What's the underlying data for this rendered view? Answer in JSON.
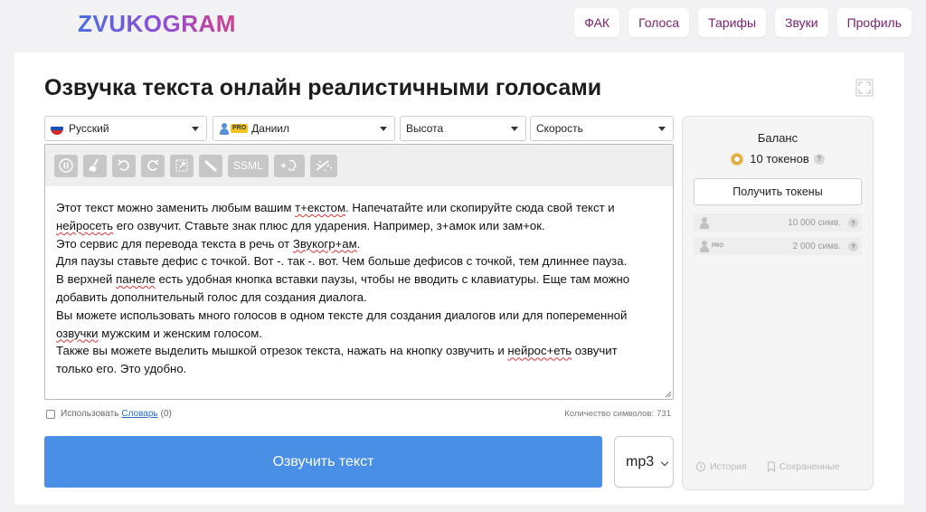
{
  "brand": {
    "name": "ZVUKOGRAM"
  },
  "nav": [
    "ФАК",
    "Голоса",
    "Тарифы",
    "Звуки",
    "Профиль"
  ],
  "page": {
    "title": "Озвучка текста онлайн реалистичными голосами"
  },
  "selects": {
    "language": "Русский",
    "voice": "Даниил",
    "voice_badge": "PRO",
    "pitch": "Высота",
    "speed": "Скорость"
  },
  "toolbar": {
    "ssml_label": "SSML"
  },
  "editor": {
    "lines": [
      [
        "Этот текст можно заменить любым вашим ",
        {
          "w": "т+екстом"
        },
        ". Напечатайте или скопируйте сюда свой текст и"
      ],
      [
        {
          "w": "нейросеть"
        },
        " его озвучит. Ставьте знак плюс для ударения. Например, з+амок или зам+ок."
      ],
      [
        "Это сервис для перевода текста в речь от ",
        {
          "w": "Звукогр+ам"
        },
        "."
      ],
      [
        "Для паузы ставьте дефис с точкой. Вот -. так -. вот. Чем больше дефисов с точкой, тем длиннее пауза."
      ],
      [
        "В верхней ",
        {
          "w": "панеле"
        },
        " есть удобная кнопка вставки паузы, чтобы не вводить с клавиатуры. Еще там можно"
      ],
      [
        "добавить дополнительный голос для создания диалога."
      ],
      [
        "Вы можете использовать много голосов в одном тексте для создания диалогов или для попеременной"
      ],
      [
        {
          "w": "озвучки"
        },
        " мужским и женским голосом."
      ],
      [
        "Также вы можете выделить мышкой отрезок текста, нажать на кнопку озвучить и ",
        {
          "w": "нейрос+еть"
        },
        " озвучит"
      ],
      [
        "только его. Это удобно."
      ]
    ]
  },
  "dictionary": {
    "prefix": "Использовать",
    "link": "Словарь",
    "count": "(0)"
  },
  "char_count": {
    "label": "Количество символов:",
    "value": "731"
  },
  "actions": {
    "voice_button": "Озвучить текст",
    "format": "mp3"
  },
  "balance": {
    "title": "Баланс",
    "tokens": "10 токенов",
    "get_tokens": "Получить токены",
    "quota_standard": "10 000 симв.",
    "quota_pro": "2 000 симв.",
    "pro_label": "PRO",
    "history": "История",
    "saved": "Сохраненные"
  },
  "colors": {
    "primary": "#4a8fe6",
    "nav_text": "#7a1f6e",
    "logo_gradient": [
      "#4a6fe0",
      "#d0408e"
    ]
  }
}
